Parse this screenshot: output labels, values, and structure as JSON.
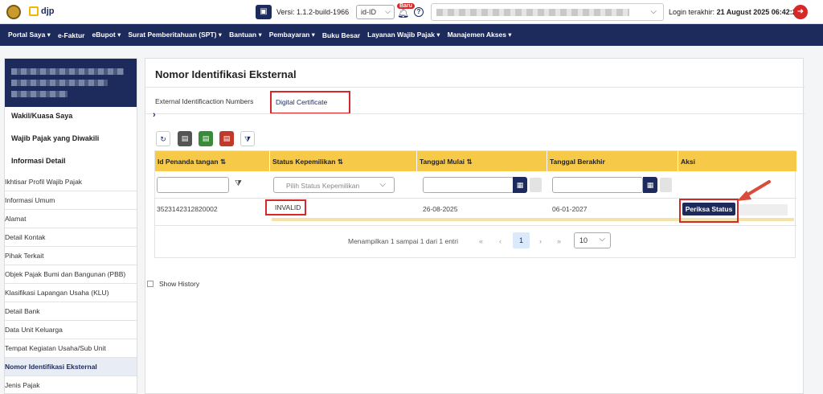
{
  "topbar": {
    "logo_text": "djp",
    "versi_label": "Versi:",
    "versi_value": "1.1.2-build-1966",
    "lang": "id-ID",
    "badge": "Baru",
    "login_label": "Login terakhir:",
    "login_value": "21 August 2025 06:42:24"
  },
  "nav": [
    "Portal Saya ▾",
    "e-Faktur",
    "eBupot ▾",
    "Surat Pemberitahuan (SPT) ▾",
    "Bantuan ▾",
    "Pembayaran ▾",
    "Buku Besar",
    "Layanan Wajib Pajak ▾",
    "Manajemen Akses ▾"
  ],
  "sidebar": {
    "section_items": [
      "Wakil/Kuasa Saya",
      "Wajib Pajak yang Diwakili",
      "Informasi Detail"
    ],
    "items": [
      "Ikhtisar Profil Wajib Pajak",
      "Informasi Umum",
      "Alamat",
      "Detail Kontak",
      "Pihak Terkait",
      "Objek Pajak Bumi dan Bangunan (PBB)",
      "Klasifikasi Lapangan Usaha (KLU)",
      "Detail Bank",
      "Data Unit Keluarga",
      "Tempat Kegiatan Usaha/Sub Unit",
      "Nomor Identifikasi Eksternal",
      "Jenis Pajak"
    ]
  },
  "main": {
    "title": "Nomor Identifikasi Eksternal",
    "tabs": [
      "External Identificaction Numbers",
      "Digital Certificate"
    ],
    "columns": [
      "Id Penanda tangan ⇅",
      "Status Kepemilikan ⇅",
      "Tanggal Mulai ⇅",
      "Tanggal Berakhir",
      "Aksi"
    ],
    "filter_placeholder": "Pilih Status Kepemilikan",
    "row": {
      "id": "3523142312820002",
      "status": "INVALID",
      "start": "26-08-2025",
      "end": "06-01-2027",
      "action": "Periksa Status"
    },
    "pager": {
      "text": "Menampilkan 1 sampai 1 dari 1 entri",
      "page": "1",
      "size": "10"
    },
    "show_history": "Show History"
  },
  "colors": {
    "navy": "#1d2a5c",
    "header_yellow": "#f7c948",
    "highlight_red": "#d62828"
  }
}
